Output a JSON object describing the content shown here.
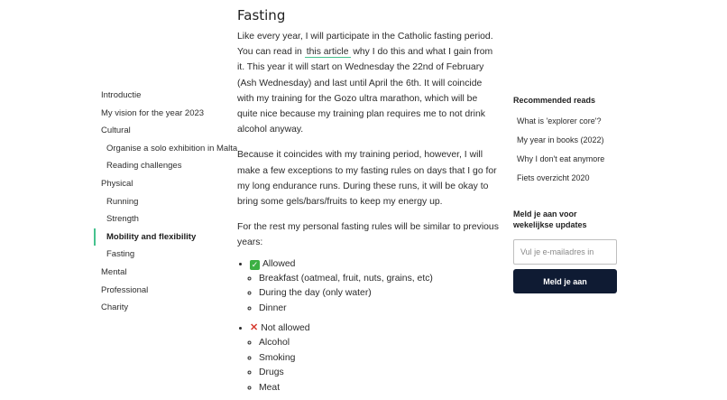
{
  "toc": {
    "items": [
      {
        "label": "Introductie"
      },
      {
        "label": "My vision for the year 2023"
      },
      {
        "label": "Cultural"
      },
      {
        "label": "Organise a solo exhibition in Malta"
      },
      {
        "label": "Reading challenges"
      },
      {
        "label": "Physical"
      },
      {
        "label": "Running"
      },
      {
        "label": "Strength"
      },
      {
        "label": "Mobility and flexibility"
      },
      {
        "label": "Fasting"
      },
      {
        "label": "Mental"
      },
      {
        "label": "Professional"
      },
      {
        "label": "Charity"
      }
    ]
  },
  "article": {
    "heading": "Fasting",
    "p1_before": "Like every year, I will participate in the Catholic fasting period. You can read in ",
    "p1_link": "this article",
    "p1_after": " why I do this and what I gain from it. This year it will start on Wednesday the 22nd of February (Ash Wednesday) and last until April the 6th. It will coincide with my training for the Gozo ultra marathon, which will be quite nice because my training plan requires me to not drink alcohol anyway.",
    "p2": "Because it coincides with my training period, however, I will make a few exceptions to my fasting rules on days that I go for my long endurance runs. During these runs, it will be okay to bring some gels/bars/fruits to keep my energy up.",
    "p3": "For the rest my personal fasting rules will be similar to previous years:",
    "allowed": {
      "label": "Allowed",
      "items": [
        "Breakfast (oatmeal, fruit, nuts, grains, etc)",
        "During the day (only water)",
        "Dinner"
      ]
    },
    "not_allowed": {
      "label": "Not allowed",
      "items": [
        "Alcohol",
        "Smoking",
        "Drugs",
        "Meat"
      ]
    }
  },
  "sidebar": {
    "reads_title": "Recommended reads",
    "reads": [
      "What is 'explorer core'?",
      "My year in books (2022)",
      "Why I don't eat anymore",
      "Fiets overzicht 2020"
    ],
    "newsletter_title": "Meld je aan voor wekelijkse updates",
    "email_placeholder": "Vul je e-mailadres in",
    "submit_label": "Meld je aan"
  },
  "colors": {
    "accent": "#46c28e",
    "button_bg": "#0f1b33",
    "allowed_icon": "#3cb043",
    "not_allowed_icon": "#d63b2f"
  },
  "icons": {
    "allowed": "check-mark-icon",
    "not_allowed": "cross-mark-icon"
  }
}
